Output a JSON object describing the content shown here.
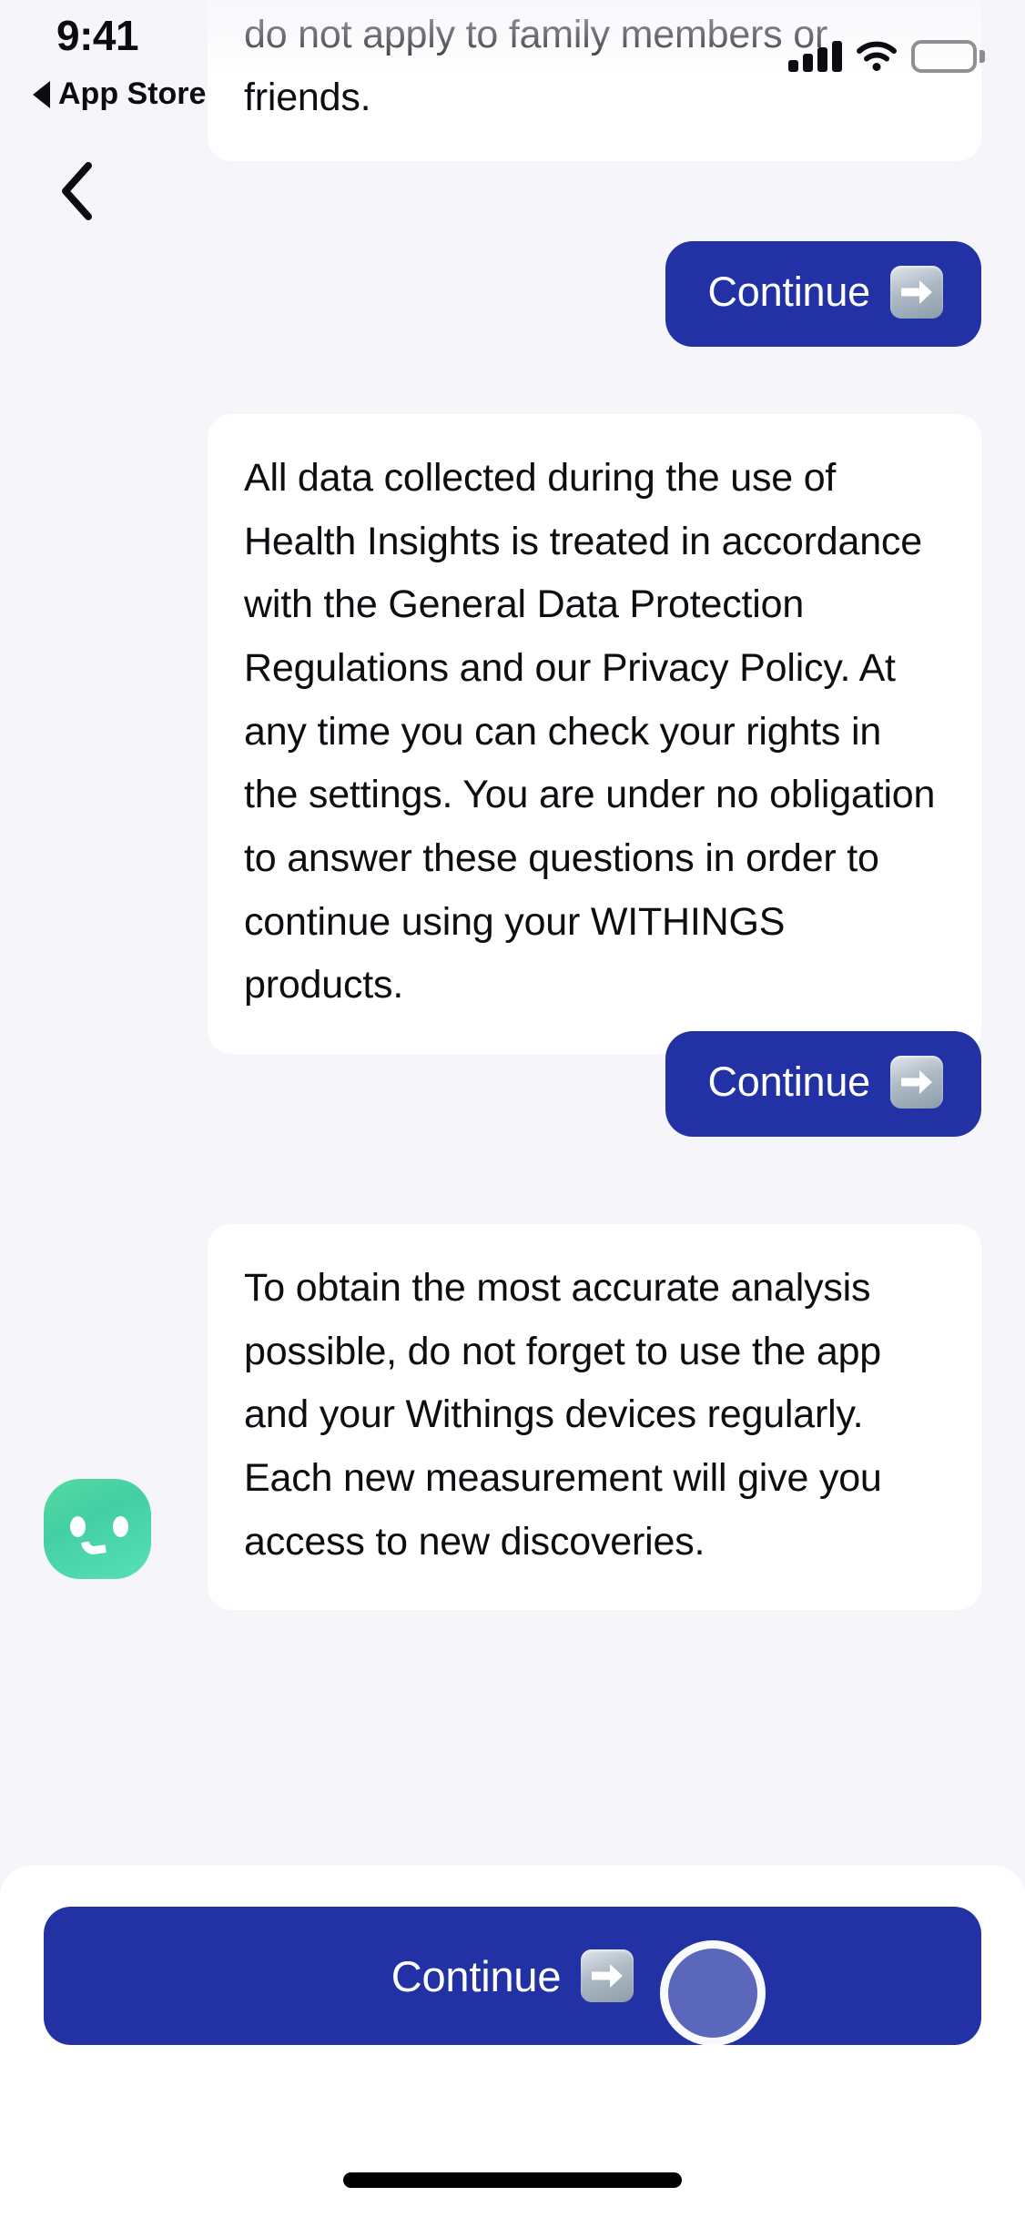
{
  "app": {
    "background_color": "#f5f5fa",
    "accent_color": "#2232a4",
    "bubble_color": "#ffffff",
    "avatar_color": "#4bd5a6"
  },
  "status_bar": {
    "time": "9:41",
    "return_label": "App Store",
    "return_icon": "back-triangle-icon",
    "cellular_icon": "cellular-bars-icon",
    "wifi_icon": "wifi-icon",
    "battery_icon": "battery-full-icon"
  },
  "nav": {
    "back_icon": "chevron-left-icon",
    "back_label": "Back"
  },
  "chat": {
    "messages": [
      {
        "id": "intro",
        "sender": "assistant",
        "text": "Health Insights are for your use only and do not apply to family members or friends."
      },
      {
        "id": "continue-1",
        "sender": "user",
        "text": "Continue",
        "icon": "arrow-right-emoji-icon"
      },
      {
        "id": "gdpr",
        "sender": "assistant",
        "text": "All data collected during the use of Health Insights is treated in accordance with the General Data Protection Regulations and our Privacy Policy. At any time you can check your rights in the settings. You are under no obligation to answer these questions in order to continue using your WITHINGS products."
      },
      {
        "id": "continue-2",
        "sender": "user",
        "text": "Continue",
        "icon": "arrow-right-emoji-icon"
      },
      {
        "id": "accuracy",
        "sender": "assistant",
        "text": "To obtain the most accurate analysis possible, do not forget to use the app and your Withings devices regularly. Each new measurement will give you access to new discoveries.",
        "avatar_icon": "assistant-face-icon"
      }
    ]
  },
  "footer": {
    "continue_label": "Continue",
    "continue_icon": "arrow-right-emoji-icon",
    "touch_indicator": "tap-highlight",
    "home_indicator": "home-indicator"
  }
}
